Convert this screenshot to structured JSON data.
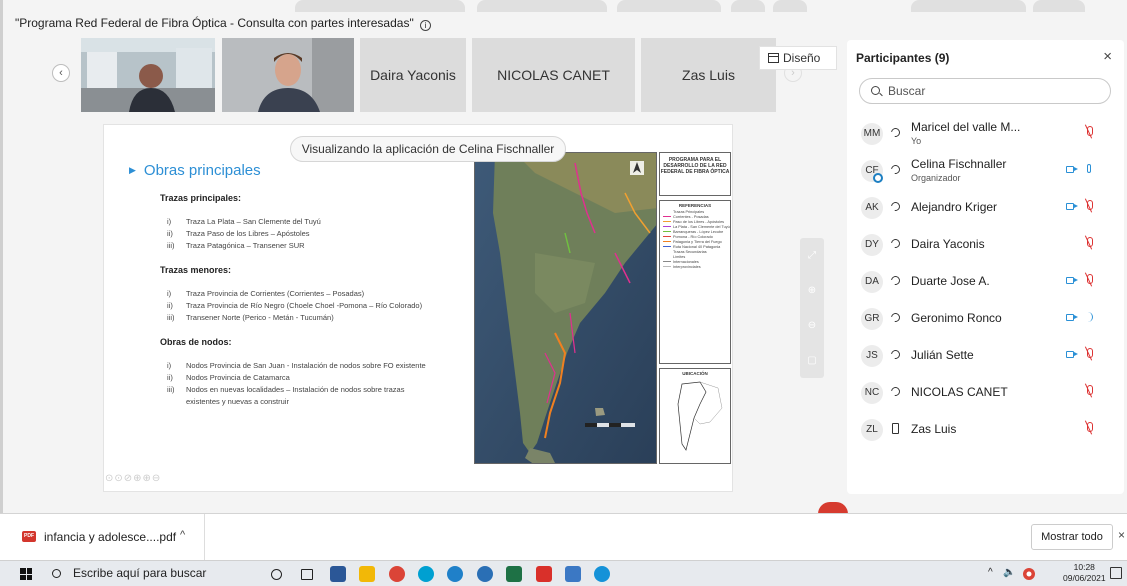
{
  "meeting": {
    "title": "\"Programa Red Federal de Fibra Óptica - Consulta con partes interesadas\"",
    "info_glyph": "i",
    "layout_label": "Diseño",
    "sharing_banner": "Visualizando la aplicación de Celina Fischnaller",
    "tiles": [
      "Daira Yaconis",
      "NICOLAS CANET",
      "Zas Luis"
    ]
  },
  "slide": {
    "heading": "Obras principales",
    "sections": [
      {
        "title": "Trazas principales:",
        "items": [
          {
            "num": "i)",
            "text": "Traza La Plata – San Clemente del Tuyú"
          },
          {
            "num": "ii)",
            "text": "Traza Paso de los Libres – Apóstoles"
          },
          {
            "num": "iii)",
            "text": "Traza Patagónica – Transener SUR"
          }
        ]
      },
      {
        "title": "Trazas menores:",
        "items": [
          {
            "num": "i)",
            "text": "Traza Provincia de Corrientes (Corrientes – Posadas)"
          },
          {
            "num": "ii)",
            "text": "Traza Provincia de Río Negro (Choele Choel -Pomona – Río Colorado)"
          },
          {
            "num": "iii)",
            "text": "Transener Norte (Perico - Metán - Tucumán)"
          }
        ]
      },
      {
        "title": "Obras de nodos:",
        "items": [
          {
            "num": "i)",
            "text": "Nodos Provincia de San Juan - Instalación de nodos sobre FO existente"
          },
          {
            "num": "ii)",
            "text": "Nodos Provincia de Catamarca"
          },
          {
            "num": "iii)",
            "text": "Nodos en nuevas localidades – Instalación de nodos sobre trazas"
          },
          {
            "num": "",
            "text": "existentes y nuevas a construir"
          }
        ]
      }
    ],
    "map_legend": {
      "title": "PROGRAMA PARA EL DESARROLLO DE LA RED FEDERAL DE FIBRA ÓPTICA",
      "references_title": "REFERENCIAS",
      "references": [
        {
          "label": "Trazas Principales",
          "color": "#ffffff"
        },
        {
          "label": "Corrientes - Posadas",
          "color": "#e0308f"
        },
        {
          "label": "Paso de los Libres - Apóstoles",
          "color": "#f0a030"
        },
        {
          "label": "La Plata - San Clemente del Tuyú",
          "color": "#b040d0"
        },
        {
          "label": "Barranqueras - López Lecube",
          "color": "#70c040"
        },
        {
          "label": "Pomona - Río Colorado",
          "color": "#e04040"
        },
        {
          "label": "Patagonia y Tierra del Fuego",
          "color": "#f08020"
        },
        {
          "label": "Ruta Nacional 40 Patagonia",
          "color": "#4060d0"
        },
        {
          "label": "Trazas Secundarias",
          "color": "#ffffff"
        },
        {
          "label": "Límites",
          "color": "#ffffff"
        },
        {
          "label": "Internacionales",
          "color": "#888888"
        },
        {
          "label": "Interprovinciales",
          "color": "#bbbbbb"
        }
      ],
      "location_title": "UBICACIÓN"
    }
  },
  "panel": {
    "title": "Participantes (9)",
    "close_glyph": "×",
    "search_placeholder": "Buscar",
    "participants": [
      {
        "initials": "MM",
        "name": "Maricel del valle M...",
        "sub": "Yo",
        "audio": "sound",
        "video": false,
        "mic": "muted",
        "ring": false
      },
      {
        "initials": "CF",
        "name": "Celina Fischnaller",
        "sub": "Organizador",
        "audio": "sound",
        "video": true,
        "mic": "on",
        "ring": true
      },
      {
        "initials": "AK",
        "name": "Alejandro Kriger",
        "sub": "",
        "audio": "sound",
        "video": true,
        "mic": "muted",
        "ring": false
      },
      {
        "initials": "DY",
        "name": "Daira Yaconis",
        "sub": "",
        "audio": "sound",
        "video": false,
        "mic": "muted",
        "ring": false
      },
      {
        "initials": "DA",
        "name": "Duarte Jose A.",
        "sub": "",
        "audio": "sound",
        "video": true,
        "mic": "muted",
        "ring": false
      },
      {
        "initials": "GR",
        "name": "Geronimo Ronco",
        "sub": "",
        "audio": "sound",
        "video": true,
        "mic": "speaking",
        "ring": false
      },
      {
        "initials": "JS",
        "name": "Julián Sette",
        "sub": "",
        "audio": "sound",
        "video": true,
        "mic": "muted",
        "ring": false
      },
      {
        "initials": "NC",
        "name": "NICOLAS CANET",
        "sub": "",
        "audio": "sound",
        "video": false,
        "mic": "muted",
        "ring": false
      },
      {
        "initials": "ZL",
        "name": "Zas Luis",
        "sub": "",
        "audio": "device",
        "video": false,
        "mic": "muted",
        "ring": false
      }
    ]
  },
  "downloads": {
    "file_name": "infancia y adolesce....pdf",
    "file_badge": "PDF",
    "chevron": "^",
    "show_all": "Mostrar todo",
    "close_glyph": "×"
  },
  "taskbar": {
    "search_placeholder": "Escribe aquí para buscar",
    "time": "10:28",
    "date": "09/06/2021",
    "app_icons": [
      {
        "name": "cortana-icon",
        "color": "transparent"
      },
      {
        "name": "task-view-icon",
        "color": "transparent"
      },
      {
        "name": "word-icon",
        "color": "#2b5797"
      },
      {
        "name": "file-explorer-icon",
        "color": "#f2b807"
      },
      {
        "name": "chrome-icon",
        "color": "#db4437"
      },
      {
        "name": "webex-icon",
        "color": "#00a0d1"
      },
      {
        "name": "edge-icon",
        "color": "#1f80c9"
      },
      {
        "name": "firefox-icon",
        "color": "#2a6fb5"
      },
      {
        "name": "excel-icon",
        "color": "#1e7145"
      },
      {
        "name": "acrobat-icon",
        "color": "#d9302a"
      },
      {
        "name": "photos-icon",
        "color": "#3b78c4"
      },
      {
        "name": "cortana-circle-icon",
        "color": "#1592d8"
      }
    ]
  },
  "colors": {
    "accent": "#2a90d6",
    "muted_mic": "#dd3333",
    "leave_button": "#d63b2f"
  }
}
